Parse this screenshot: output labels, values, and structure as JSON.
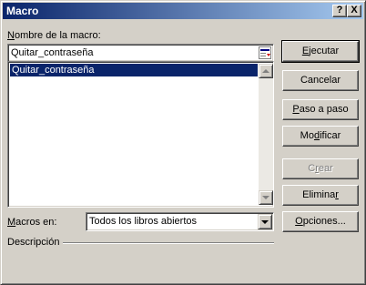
{
  "window": {
    "title": "Macro",
    "help_button": "?",
    "close_button": "X"
  },
  "macro_name": {
    "label_pre": "N",
    "label_rest": "ombre de la macro:",
    "value": "Quitar_contraseña"
  },
  "macro_list": {
    "items": [
      "Quitar_contraseña"
    ],
    "selected_index": 0
  },
  "buttons": {
    "run": {
      "pre": "",
      "key": "E",
      "post": "jecutar"
    },
    "cancel": {
      "label": "Cancelar"
    },
    "step_into": {
      "pre": "",
      "key": "P",
      "post": "aso a paso"
    },
    "edit": {
      "pre": "Mo",
      "key": "d",
      "post": "ificar"
    },
    "create": {
      "pre": "C",
      "key": "r",
      "post": "ear"
    },
    "delete": {
      "pre": "Elimina",
      "key": "r",
      "post": ""
    },
    "options": {
      "pre": "",
      "key": "O",
      "post": "pciones..."
    }
  },
  "macros_in": {
    "label_pre": "",
    "label_key": "M",
    "label_post": "acros en:",
    "selected": "Todos los libros abiertos"
  },
  "description": {
    "label": "Descripción"
  }
}
